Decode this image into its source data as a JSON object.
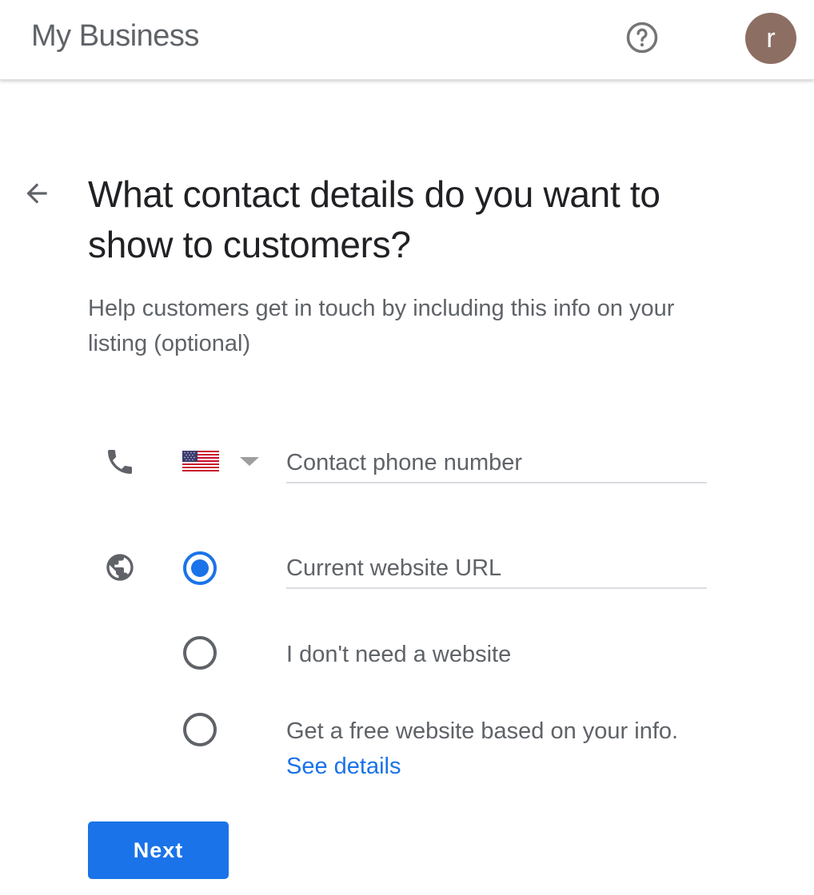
{
  "header": {
    "app_title": "My Business",
    "help_icon": "help-circle-icon",
    "avatar_initial": "r",
    "avatar_color": "#8d6e63"
  },
  "page": {
    "back_icon": "arrow-back-icon",
    "title": "What contact details do you want to show to customers?",
    "subtitle": "Help customers get in touch by including this info on your listing (optional)"
  },
  "phone": {
    "icon": "phone-icon",
    "country_flag": "us-flag-icon",
    "country_dropdown_icon": "caret-down-icon",
    "placeholder": "Contact phone number",
    "value": ""
  },
  "website": {
    "icon": "globe-icon",
    "options": [
      {
        "type": "input",
        "placeholder": "Current website URL",
        "value": "",
        "checked": true
      },
      {
        "type": "label",
        "label": "I don't need a website",
        "checked": false
      },
      {
        "type": "label",
        "label": "Get a free website based on your info.",
        "link": "See details",
        "checked": false
      }
    ]
  },
  "actions": {
    "next_label": "Next"
  },
  "colors": {
    "accent": "#1a73e8",
    "text_primary": "#202124",
    "text_secondary": "#5f6368"
  }
}
